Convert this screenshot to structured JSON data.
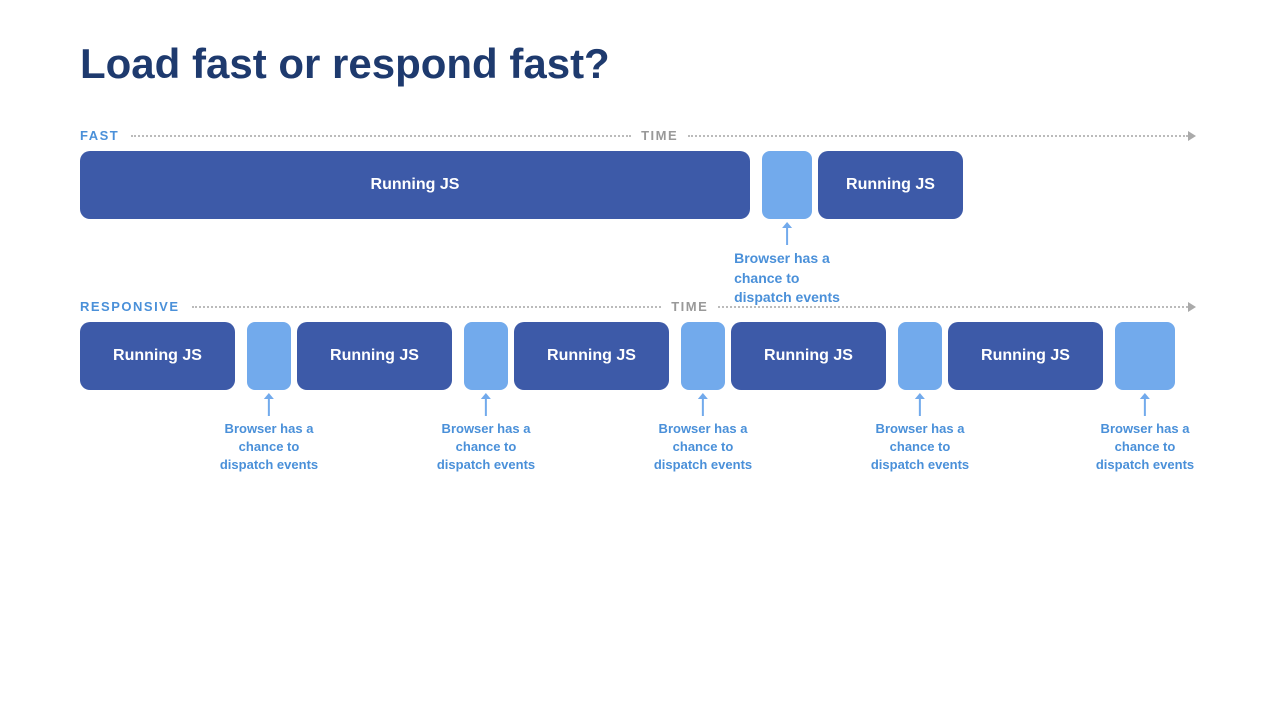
{
  "title": "Load fast or respond fast?",
  "fast_section": {
    "label": "FAST",
    "time_label": "TIME",
    "running_js_label": "Running JS",
    "browser_annotation": "Browser has a\nchance to\ndispatch events"
  },
  "responsive_section": {
    "label": "RESPONSIVE",
    "time_label": "TIME",
    "running_js_label": "Running JS",
    "browser_annotations": [
      "Browser has a\nchance to\ndispatch events",
      "Browser has a\nchance to\ndispatch events",
      "Browser has a\nchance to\ndispatch events",
      "Browser has a\nchance to\ndispatch events",
      "Browser has a\nchance to\ndispatch events"
    ]
  }
}
